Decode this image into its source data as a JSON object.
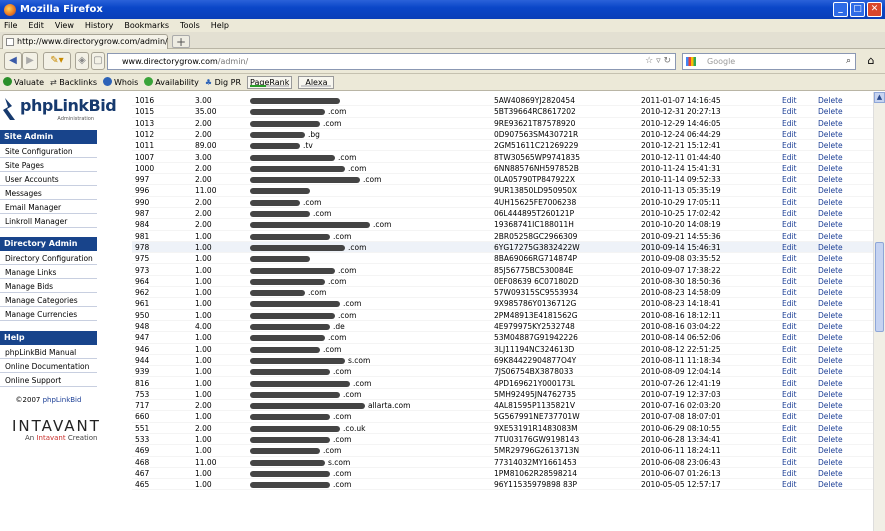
{
  "window": {
    "title": "Mozilla Firefox"
  },
  "menu": [
    "File",
    "Edit",
    "View",
    "History",
    "Bookmarks",
    "Tools",
    "Help"
  ],
  "tab": {
    "label": "http://www.directorygrow.com/admin/"
  },
  "url": {
    "domain": "www.directorygrow.com",
    "path": "/admin/"
  },
  "search": {
    "placeholder": "Google"
  },
  "seo_toolbar": {
    "valuate": "Valuate",
    "backlinks": "Backlinks",
    "whois": "Whois",
    "availability": "Availability",
    "digpr": "Dig PR",
    "pagerank": "PageRank",
    "alexa": "Alexa",
    "pagerank_level": 0.4
  },
  "logo": {
    "name": "phpLinkBid",
    "sub": "Administration"
  },
  "sidebar": {
    "site_admin": {
      "title": "Site Admin",
      "items": [
        "Site Configuration",
        "Site Pages",
        "User Accounts",
        "Messages",
        "Email Manager",
        "Linkroll Manager"
      ]
    },
    "directory_admin": {
      "title": "Directory Admin",
      "items": [
        "Directory Configuration",
        "Manage Links",
        "Manage Bids",
        "Manage Categories",
        "Manage Currencies"
      ]
    },
    "help": {
      "title": "Help",
      "items": [
        "phpLinkBid Manual",
        "Online Documentation",
        "Online Support"
      ]
    },
    "copyright": "©2007",
    "copyright_link": "phpLinkBid",
    "company": "INTAVANT",
    "company_sub_prefix": "An",
    "company_sub_brand": "Intavant",
    "company_sub_suffix": "Creation"
  },
  "actions": {
    "edit": "Edit",
    "delete": "Delete"
  },
  "rows": [
    {
      "id": "1016",
      "amount": "3.00",
      "url": "",
      "key": "5AW40869YJ2820454",
      "date": "2011-01-07 14:16:45"
    },
    {
      "id": "1015",
      "amount": "35.00",
      "url": ".com",
      "key": "5BT39664RC8617202",
      "date": "2010-12-31 20:27:13"
    },
    {
      "id": "1013",
      "amount": "2.00",
      "url": ".com",
      "key": "9RE93621T87578920",
      "date": "2010-12-29 14:46:05"
    },
    {
      "id": "1012",
      "amount": "2.00",
      "url": ".bg",
      "key": "0D907563SM430721R",
      "date": "2010-12-24 06:44:29"
    },
    {
      "id": "1011",
      "amount": "89.00",
      "url": ".tv",
      "key": "2GM51611C21269229",
      "date": "2010-12-21 15:12:41"
    },
    {
      "id": "1007",
      "amount": "3.00",
      "url": ".com",
      "key": "8TW30565WP9741835",
      "date": "2010-12-11 01:44:40"
    },
    {
      "id": "1000",
      "amount": "2.00",
      "url": ".com",
      "key": "6NN88576NH597852B",
      "date": "2010-11-24 15:41:31"
    },
    {
      "id": "997",
      "amount": "2.00",
      "url": ".com",
      "key": "0LA05790TP847922X",
      "date": "2010-11-14 09:52:33"
    },
    {
      "id": "996",
      "amount": "11.00",
      "url": "",
      "key": "9UR13850LD950950X",
      "date": "2010-11-13 05:35:19"
    },
    {
      "id": "990",
      "amount": "2.00",
      "url": ".com",
      "key": "4UH15625FE7006238",
      "date": "2010-10-29 17:05:11"
    },
    {
      "id": "987",
      "amount": "2.00",
      "url": ".com",
      "key": "06L444895T260121P",
      "date": "2010-10-25 17:02:42"
    },
    {
      "id": "984",
      "amount": "2.00",
      "url": ".com",
      "key": "19368741IC188011H",
      "date": "2010-10-20 14:08:19"
    },
    {
      "id": "981",
      "amount": "1.00",
      "url": ".com",
      "key": "2BR05258GC2966309",
      "date": "2010-09-21 14:55:36"
    },
    {
      "id": "978",
      "amount": "1.00",
      "url": ".com",
      "key": "6YG17275G3832422W",
      "date": "2010-09-14 15:46:31"
    },
    {
      "id": "975",
      "amount": "1.00",
      "url": "",
      "key": "8BA69066RG714874P",
      "date": "2010-09-08 03:35:52"
    },
    {
      "id": "973",
      "amount": "1.00",
      "url": ".com",
      "key": "85J56775BC530084E",
      "date": "2010-09-07 17:38:22"
    },
    {
      "id": "964",
      "amount": "1.00",
      "url": ".com",
      "key": "0EF08639 6C071802D",
      "date": "2010-08-30 18:50:36"
    },
    {
      "id": "962",
      "amount": "1.00",
      "url": ".com",
      "key": "57W09315SC9553934",
      "date": "2010-08-23 14:58:09"
    },
    {
      "id": "961",
      "amount": "1.00",
      "url": ".com",
      "key": "9X985786Y0136712G",
      "date": "2010-08-23 14:18:41"
    },
    {
      "id": "950",
      "amount": "1.00",
      "url": ".com",
      "key": "2PM48913E4181562G",
      "date": "2010-08-16 18:12:11"
    },
    {
      "id": "948",
      "amount": "4.00",
      "url": ".de",
      "key": "4E979975KY2532748",
      "date": "2010-08-16 03:04:22"
    },
    {
      "id": "947",
      "amount": "1.00",
      "url": ".com",
      "key": "53M04887G91942226",
      "date": "2010-08-14 06:52:06"
    },
    {
      "id": "946",
      "amount": "1.00",
      "url": ".com",
      "key": "3LJ11194NC324613D",
      "date": "2010-08-12 22:51:25"
    },
    {
      "id": "944",
      "amount": "1.00",
      "url": "s.com",
      "key": "69K84422904877O4Y",
      "date": "2010-08-11 11:18:34"
    },
    {
      "id": "939",
      "amount": "1.00",
      "url": ".com",
      "key": "7JS06754BX3878033",
      "date": "2010-08-09 12:04:14"
    },
    {
      "id": "816",
      "amount": "1.00",
      "url": ".com",
      "key": "4PD169621Y000173L",
      "date": "2010-07-26 12:41:19"
    },
    {
      "id": "753",
      "amount": "1.00",
      "url": ".com",
      "key": "5MH92495JN4762735",
      "date": "2010-07-19 12:37:03"
    },
    {
      "id": "717",
      "amount": "2.00",
      "url": "allarta.com",
      "key": "4AL81595P1135821V",
      "date": "2010-07-16 02:03:20"
    },
    {
      "id": "660",
      "amount": "1.00",
      "url": ".com",
      "key": "5G567991NE737701W",
      "date": "2010-07-08 18:07:01"
    },
    {
      "id": "551",
      "amount": "2.00",
      "url": ".co.uk",
      "key": "9XE53191R1483083M",
      "date": "2010-06-29 08:10:55"
    },
    {
      "id": "533",
      "amount": "1.00",
      "url": ".com",
      "key": "7TU03176GW9198143",
      "date": "2010-06-28 13:34:41"
    },
    {
      "id": "469",
      "amount": "1.00",
      "url": ".com",
      "key": "5MR29796G2613713N",
      "date": "2010-06-11 18:24:11"
    },
    {
      "id": "468",
      "amount": "11.00",
      "url": "s.com",
      "key": "77314032MY1661453",
      "date": "2010-06-08 23:06:43"
    },
    {
      "id": "467",
      "amount": "1.00",
      "url": ".com",
      "key": "1PM81062R28598214",
      "date": "2010-06-07 01:26:13"
    },
    {
      "id": "465",
      "amount": "1.00",
      "url": ".com",
      "key": "96Y11535979898 83P",
      "date": "2010-05-05 12:57:17"
    }
  ]
}
